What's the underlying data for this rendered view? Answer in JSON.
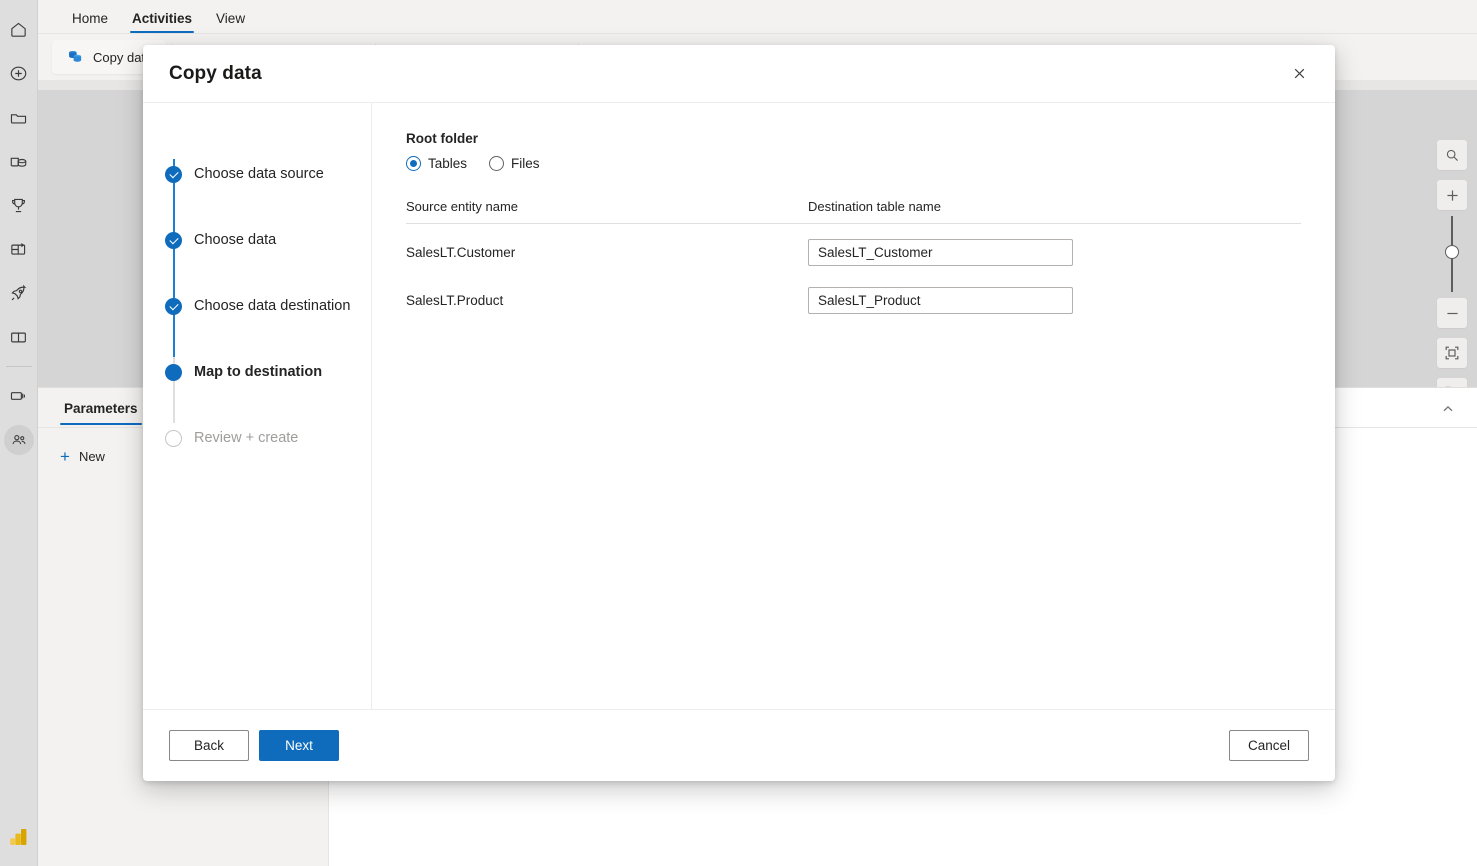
{
  "app": {
    "ribbon_tabs": [
      {
        "label": "Home",
        "active": false
      },
      {
        "label": "Activities",
        "active": true
      },
      {
        "label": "View",
        "active": false
      }
    ],
    "command_bar": {
      "copy_data_label": "Copy data"
    },
    "rail_icons": [
      "home-icon",
      "create-icon",
      "workspaces-folder-icon",
      "onelake-database-icon",
      "trophy-icon",
      "apps-grid-icon",
      "deploy-rocket-icon",
      "learn-book-icon",
      "monitor-icon",
      "people-icon"
    ],
    "rail_bottom_icon": "power-bi-logo-icon"
  },
  "parameters_panel": {
    "tab_label": "Parameters",
    "new_label": "New",
    "collapse_icon": "chevron-up-icon"
  },
  "zoom_tools": [
    "search-zoom-icon",
    "zoom-in-plus-icon",
    "zoom-slider",
    "zoom-out-minus-icon",
    "fit-to-screen-icon",
    "auto-layout-icon"
  ],
  "dialog": {
    "title": "Copy data",
    "close_icon": "close-icon",
    "steps": [
      {
        "label": "Choose data source",
        "state": "done"
      },
      {
        "label": "Choose data",
        "state": "done"
      },
      {
        "label": "Choose data destination",
        "state": "done"
      },
      {
        "label": "Map to destination",
        "state": "current"
      },
      {
        "label": "Review + create",
        "state": "todo"
      }
    ],
    "content": {
      "root_folder_label": "Root folder",
      "radio_options": [
        {
          "label": "Tables",
          "checked": true
        },
        {
          "label": "Files",
          "checked": false
        }
      ],
      "columns": {
        "source": "Source entity name",
        "destination": "Destination table name"
      },
      "mappings": [
        {
          "source": "SalesLT.Customer",
          "destination": "SalesLT_Customer"
        },
        {
          "source": "SalesLT.Product",
          "destination": "SalesLT_Product"
        }
      ]
    },
    "footer": {
      "back_label": "Back",
      "next_label": "Next",
      "cancel_label": "Cancel"
    }
  },
  "colors": {
    "accent": "#0f6cbd",
    "rail_bg": "#dededf",
    "canvas_bg": "#d6d5d5",
    "panel_bg": "#f3f2f1"
  }
}
